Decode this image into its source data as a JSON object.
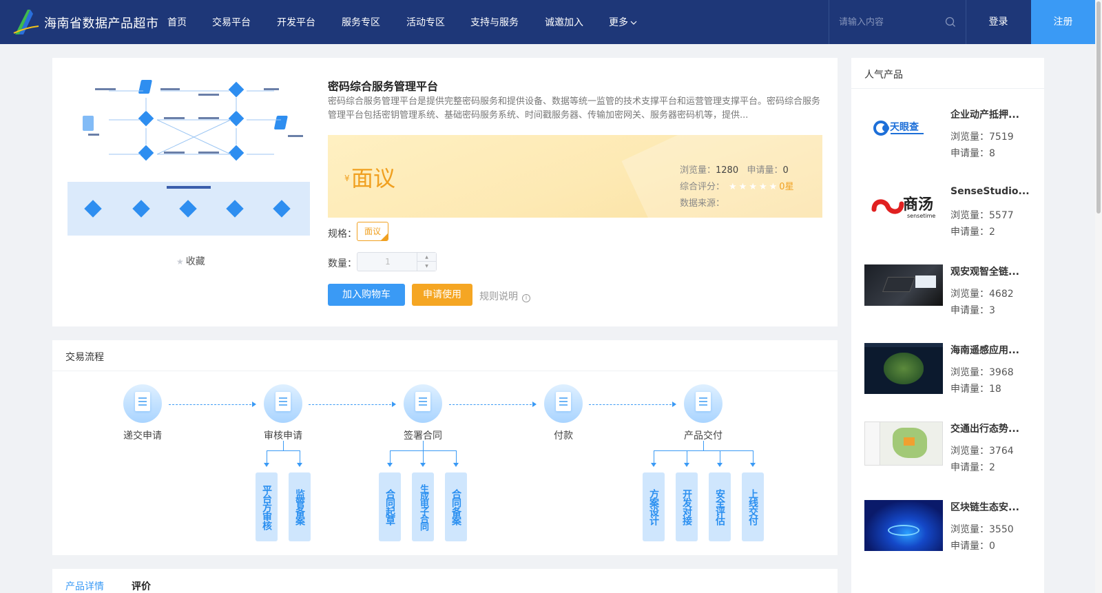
{
  "header": {
    "site_title": "海南省数据产品超市",
    "nav": [
      "首页",
      "交易平台",
      "开发平台",
      "服务专区",
      "活动专区",
      "支持与服务",
      "诚邀加入",
      "更多"
    ],
    "search_placeholder": "请输入内容",
    "login_label": "登录",
    "register_label": "注册",
    "colors": {
      "bar": "#1e3778",
      "accent": "#3a9af5"
    }
  },
  "product": {
    "title": "密码综合服务管理平台",
    "description": "密码综合服务管理平台是提供完整密码服务和提供设备、数据等统一监管的技术支撑平台和运营管理支撑平台。密码综合服务管理平台包括密钥管理系统、基础密码服务系统、时间戳服务器、传输加密网关、服务器密码机等，提供...",
    "favorite_label": "收藏",
    "currency": "¥",
    "price": "面议",
    "views_label": "浏览量：",
    "views": "1280",
    "applies_label": "申请量：",
    "applies": "0",
    "rating_label": "综合评分：",
    "rating_stars": 0,
    "rating_text": "0星",
    "source_label": "数据来源：",
    "source": "",
    "spec_label": "规格：",
    "spec_value": "面议",
    "qty_label": "数量：",
    "qty_value": "1",
    "add_cart_label": "加入购物车",
    "apply_label": "申请使用",
    "rule_label": "规则说明",
    "price_color": "#f0a020"
  },
  "flow": {
    "title": "交易流程",
    "steps": [
      {
        "label": "递交申请",
        "icon": "document-icon"
      },
      {
        "label": "审核申请",
        "icon": "review-icon"
      },
      {
        "label": "签署合同",
        "icon": "contract-icon"
      },
      {
        "label": "付款",
        "icon": "payment-icon"
      },
      {
        "label": "产品交付",
        "icon": "delivery-icon"
      }
    ],
    "substeps": {
      "review": [
        "平台方审核",
        "监管备案"
      ],
      "contract": [
        "合同起草",
        "生成电子合同",
        "合同备案"
      ],
      "delivery": [
        "方案设计",
        "开发对接",
        "安全评估",
        "上线交付"
      ]
    }
  },
  "tabs": [
    "产品详情",
    "评价"
  ],
  "sidebar": {
    "title": "人气产品",
    "views_label": "浏览量：",
    "applies_label": "申请量：",
    "items": [
      {
        "name": "企业动产抵押...",
        "views": "7519",
        "applies": "8",
        "logo_text": "天眼查"
      },
      {
        "name": "SenseStudio...",
        "views": "5577",
        "applies": "2",
        "logo_text": "商汤",
        "logo_sub": "sensetime"
      },
      {
        "name": "观安观智全链...",
        "views": "4682",
        "applies": "3"
      },
      {
        "name": "海南遥感应用...",
        "views": "3968",
        "applies": "18"
      },
      {
        "name": "交通出行态势...",
        "views": "3764",
        "applies": "2"
      },
      {
        "name": "区块链生态安...",
        "views": "3550",
        "applies": "0"
      }
    ]
  }
}
